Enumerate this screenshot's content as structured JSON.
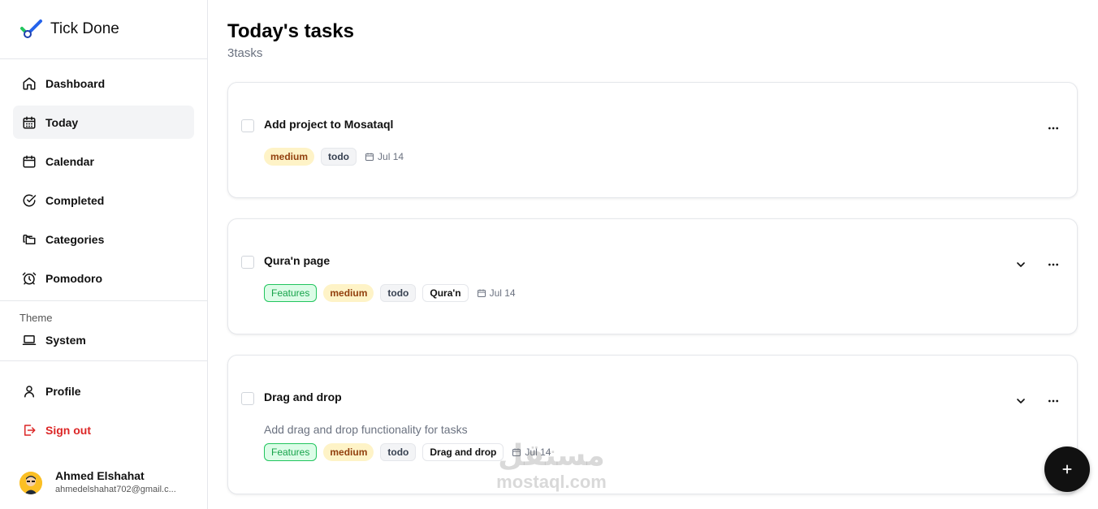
{
  "app": {
    "name": "Tick Done"
  },
  "sidebar": {
    "items": [
      {
        "label": "Dashboard",
        "icon": "home-icon"
      },
      {
        "label": "Today",
        "icon": "calendar-days-icon",
        "active": true
      },
      {
        "label": "Calendar",
        "icon": "calendar-icon"
      },
      {
        "label": "Completed",
        "icon": "check-circle-icon"
      },
      {
        "label": "Categories",
        "icon": "folders-icon"
      },
      {
        "label": "Pomodoro",
        "icon": "alarm-clock-icon"
      }
    ],
    "theme_label": "Theme",
    "theme_value": "System",
    "profile_label": "Profile",
    "signout_label": "Sign out"
  },
  "user": {
    "name": "Ahmed Elshahat",
    "email": "ahmedelshahat702@gmail.c..."
  },
  "main": {
    "title": "Today's tasks",
    "count": "3tasks"
  },
  "tasks": [
    {
      "title": "Add project to Mosataql",
      "description": "",
      "tags": [
        {
          "label": "medium",
          "kind": "priority"
        },
        {
          "label": "todo",
          "kind": "status"
        }
      ],
      "date": "Jul 14",
      "expandable": false
    },
    {
      "title": "Qura'n page",
      "description": "",
      "tags": [
        {
          "label": "Features",
          "kind": "label"
        },
        {
          "label": "medium",
          "kind": "priority"
        },
        {
          "label": "todo",
          "kind": "status"
        },
        {
          "label": "Qura'n",
          "kind": "category"
        }
      ],
      "date": "Jul 14",
      "expandable": true
    },
    {
      "title": "Drag and drop",
      "description": "Add drag and drop functionality for tasks",
      "tags": [
        {
          "label": "Features",
          "kind": "label"
        },
        {
          "label": "medium",
          "kind": "priority"
        },
        {
          "label": "todo",
          "kind": "status"
        },
        {
          "label": "Drag and drop",
          "kind": "category"
        }
      ],
      "date": "Jul 14",
      "expandable": true
    }
  ],
  "watermark": {
    "arabic": "مستقل",
    "latin": "mostaql.com"
  },
  "colors": {
    "accent_dark": "#111111",
    "signout": "#dc2626",
    "priority_medium_bg": "#fef3c7",
    "feature_green": "#22c55e",
    "logo_blue": "#3b82f6",
    "logo_green": "#22c55e"
  }
}
